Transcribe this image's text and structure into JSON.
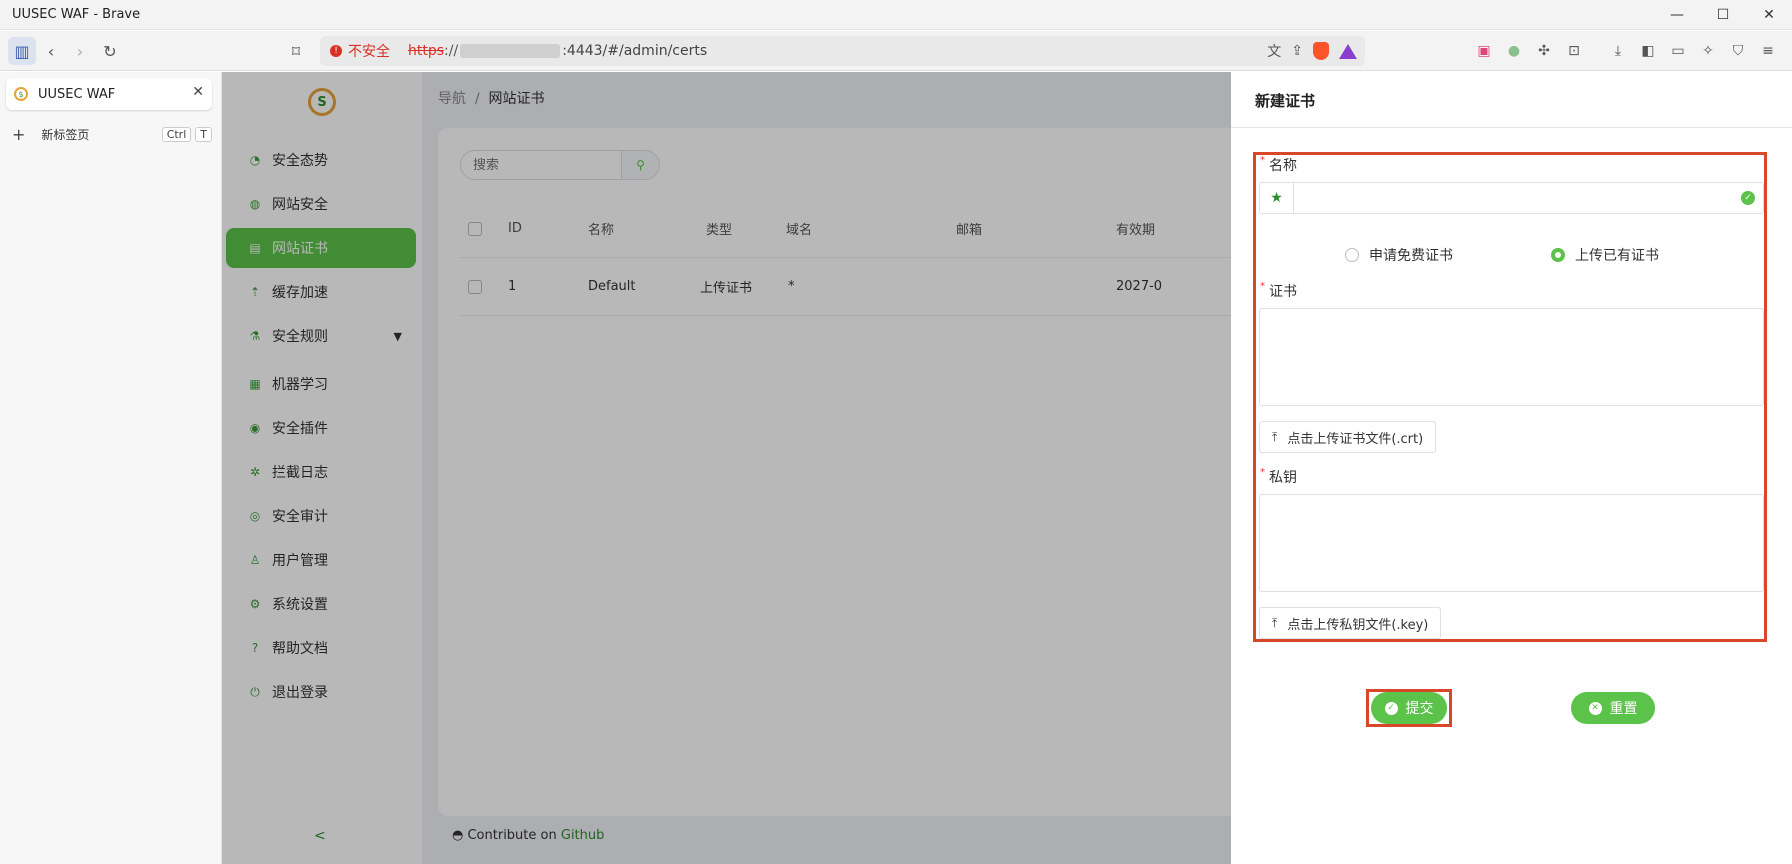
{
  "window": {
    "title": "UUSEC WAF - Brave",
    "minimize": "—",
    "maximize": "☐",
    "close": "✕"
  },
  "browser": {
    "security_label": "不安全",
    "url_scheme": "https",
    "url_sep": "://",
    "url_rest": ":4443/#/admin/certs",
    "tab_title": "UUSEC WAF",
    "new_tab_label": "新标签页",
    "new_tab_keys": [
      "Ctrl",
      "T"
    ]
  },
  "sidebar": {
    "logo": "S",
    "items": [
      {
        "label": "安全态势",
        "icon": "dashboard-icon"
      },
      {
        "label": "网站安全",
        "icon": "globe-icon"
      },
      {
        "label": "网站证书",
        "icon": "certificate-icon",
        "active": true
      },
      {
        "label": "缓存加速",
        "icon": "rocket-icon"
      },
      {
        "label": "安全规则",
        "icon": "flask-icon",
        "expandable": true
      },
      {
        "label": "机器学习",
        "icon": "machine-icon"
      },
      {
        "label": "安全插件",
        "icon": "plugin-icon"
      },
      {
        "label": "拦截日志",
        "icon": "bug-icon"
      },
      {
        "label": "安全审计",
        "icon": "eye-icon"
      },
      {
        "label": "用户管理",
        "icon": "user-icon"
      },
      {
        "label": "系统设置",
        "icon": "gear-icon"
      },
      {
        "label": "帮助文档",
        "icon": "help-icon"
      },
      {
        "label": "退出登录",
        "icon": "logout-icon"
      }
    ],
    "collapse": "<"
  },
  "main": {
    "breadcrumb_root": "导航",
    "breadcrumb_sep": "/",
    "breadcrumb_current": "网站证书",
    "search_placeholder": "搜索",
    "columns": [
      "ID",
      "名称",
      "类型",
      "域名",
      "邮箱",
      "有效期"
    ],
    "rows": [
      {
        "id": "1",
        "name": "Default",
        "type": "上传证书",
        "domain": "*",
        "email": "",
        "expiry": "2027-0"
      }
    ],
    "footer_text": "Contribute on",
    "footer_link": "Github"
  },
  "drawer": {
    "title": "新建证书",
    "name_label": "名称",
    "radio_free": "申请免费证书",
    "radio_upload": "上传已有证书",
    "cert_label": "证书",
    "cert_upload": "点击上传证书文件(.crt)",
    "key_label": "私钥",
    "key_upload": "点击上传私钥文件(.key)",
    "submit": "提交",
    "reset": "重置"
  },
  "colors": {
    "accent": "#5bc24a",
    "highlight": "#d9472b",
    "danger": "#d93025"
  }
}
